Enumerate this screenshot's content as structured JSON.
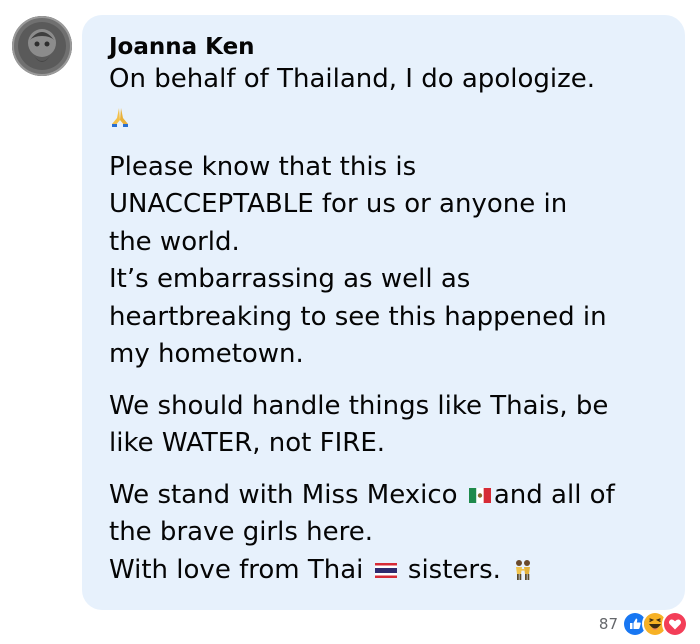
{
  "comment": {
    "author": "Joanna Ken",
    "paragraphs": [
      {
        "lines": [
          "On behalf of Thailand, I do apologize."
        ]
      },
      {
        "lines": [
          "Please know that this is",
          "UNACCEPTABLE for us or anyone in",
          "the world.",
          "It’s embarrassing as well as",
          "heartbreaking to see this happened in",
          "my hometown."
        ]
      },
      {
        "lines": [
          "We should handle things like Thais, be",
          "like WATER, not FIRE."
        ]
      },
      {
        "line1_before": "We stand with Miss Mexico",
        "line1_after": "and all of",
        "line2": "the brave girls here.",
        "line3_before": "With love from Thai",
        "line3_after": "sisters."
      }
    ],
    "emojis": {
      "prayer": "folded-hands-icon",
      "mexico": "mexico-flag-icon",
      "thailand": "thailand-flag-icon",
      "women": "women-holding-hands-icon"
    }
  },
  "reactions": {
    "count": "87",
    "icons": [
      "like-icon",
      "haha-icon",
      "love-icon"
    ],
    "colors": {
      "like": "#1877f2",
      "haha": "#f7b125",
      "love": "#f33e58"
    }
  },
  "colors": {
    "bubble": "#e7f1fc",
    "text": "#050505",
    "meta": "#65676b"
  }
}
